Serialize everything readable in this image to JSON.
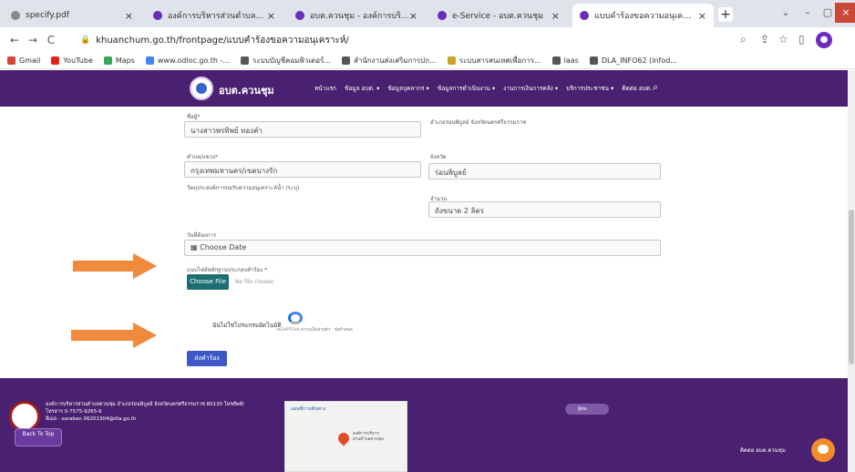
{
  "browser": {
    "tabs": [
      {
        "title": "specify.pdf",
        "fav": "#8a8a8a"
      },
      {
        "title": "องค์การบริหารส่วนตำบลควนชุม - ",
        "fav": "#6b2bbd"
      },
      {
        "title": "อบต.ควนชุม - องค์การบริหารส่วน",
        "fav": "#6b2bbd"
      },
      {
        "title": "e-Service - อบต.ควนชุม",
        "fav": "#6b2bbd"
      },
      {
        "title": "แบบคำร้องขอความอนุเคราะห์น้ำแก",
        "fav": "#6b2bbd"
      }
    ],
    "tab_close": "×",
    "new_tab": "+",
    "url": "khuanchum.go.th/frontpage/แบบคำร้องขอความอนุเคราะห์/",
    "bookmarks": [
      {
        "label": "Gmail",
        "color": "#d44638"
      },
      {
        "label": "YouTube",
        "color": "#e62117"
      },
      {
        "label": "Maps",
        "color": "#34a853"
      },
      {
        "label": "www.odloc.go.th -...",
        "color": "#4285f4"
      },
      {
        "label": "ระบบบัญชีคอมพิวเตอร์...",
        "color": "#555555"
      },
      {
        "label": "สำนักงานส่งเสริมการปก...",
        "color": "#555555"
      },
      {
        "label": "ระบบสารสนเทศเพื่อการ...",
        "color": "#c9a227"
      },
      {
        "label": "laas",
        "color": "#555555"
      },
      {
        "label": "DLA_INFO62 (infod...",
        "color": "#555555"
      }
    ]
  },
  "site": {
    "brand": "อบต.ควนชุม",
    "nav": [
      "หน้าแรก",
      "ข้อมูล อบต. ▾",
      "ข้อมูลบุคลากร ▾",
      "ข้อมูลการดำเนินงาน ▾",
      "งานการเงินการคลัง ▾",
      "บริการประชาชน ▾",
      "ติดต่อ อบต."
    ]
  },
  "form": {
    "name_label": "ชื่อผู้*",
    "name_value": "นางสาวพรทิพย์ ทองคำ",
    "right_top_label": "อำเภอร่อนพิบูลย์ จังหวัดนครศรีธรรมราช",
    "district_label": "ตำบล/แขวง*",
    "district_value": "กรุงเทพมหานคร/เขตบางรัก",
    "province_label": "จังหวัด",
    "province_value": "ร่อนพิบูลย์",
    "purpose_label": "วัตถุประสงค์การขอรับความอนุเคราะห์น้ำ (ระบุ)",
    "amount_label": "จำนวน",
    "amount_value": "ถังขนาด 2 ลิตร",
    "date_label": "วันที่ต้องการ",
    "date_placeholder": "Choose Date",
    "attach_label": "แนบไฟล์หลักฐานประกอบคำร้อง *",
    "choose_file": "Choose File",
    "no_file": "No file chosen",
    "captcha_label": "ฉันไม่ใช่โปรแกรมอัตโนมัติ",
    "captcha_small": "reCAPTCHA\nความเป็นส่วนตัว - ข้อกำหนด",
    "submit": "ส่งคำร้อง"
  },
  "footer": {
    "address": "องค์การบริหารส่วนตำบลควนชุม อำเภอร่อนพิบูลย์ จังหวัดนครศรีธรรมราช 80130 โทรศัพท์/\nโทรสาร 0-7575-9265-6\nอีเมล : saraban 06201304@dla.go.th",
    "back_top": "Back To Top",
    "map_title": "แผนที่การเดินทาง",
    "map_place": "องค์การบริหาร\nส่วนตำบลควนชุม",
    "counter": "ผู้ชม",
    "contact": "ติดต่อ อบต.ควนชุม"
  },
  "colors": {
    "nav_bg": "#4a2170",
    "footer_bg": "#4a2170",
    "arrow": "#f08a3c",
    "submit": "#3e59c7"
  }
}
